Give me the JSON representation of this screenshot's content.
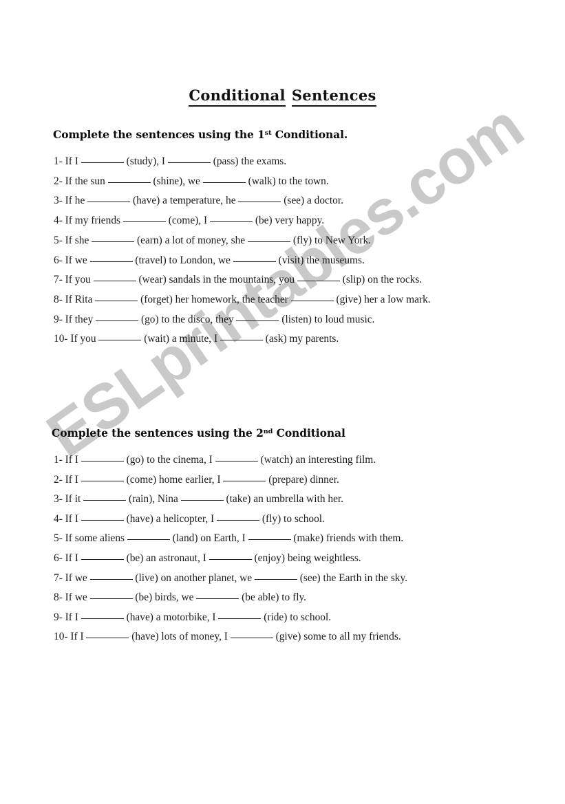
{
  "document": {
    "title_word_1": "Conditional",
    "title_word_2": "Sentences"
  },
  "watermark": {
    "text": "ESLprintables.com",
    "color": "#c9c9c9"
  },
  "colors": {
    "page_background": "#ffffff",
    "body_text": "#1c1c1c",
    "heading_text": "#0d0d0d"
  },
  "sections": [
    {
      "heading_prefix": "Complete the sentences using the 1",
      "heading_ordinal": "st",
      "heading_suffix": " Conditional.",
      "items": [
        "1- If I ________ (study), I ________ (pass) the exams.",
        "2- If the sun ________ (shine), we ________ (walk) to the town.",
        "3- If he ________ (have) a temperature, he ________ (see) a doctor.",
        "4- If my friends ________ (come), I ________ (be) very happy.",
        "5- If she ________ (earn) a lot of money, she ________ (fly) to New York.",
        "6- If we ________ (travel) to London, we ________ (visit) the museums.",
        "7- If you ________ (wear) sandals in the mountains, you ________ (slip) on the rocks.",
        "8- If Rita ________ (forget) her homework, the teacher ________ (give) her a low mark.",
        "9- If they ________ (go) to the disco, they ________ (listen) to loud music.",
        "10- If you ________ (wait) a minute, I ________ (ask) my parents."
      ]
    },
    {
      "heading_prefix": "Complete the sentences using the 2",
      "heading_ordinal": "nd",
      "heading_suffix": " Conditional",
      "items": [
        "1- If I ________ (go) to the cinema, I ________ (watch) an interesting film.",
        "2- If I ________ (come) home earlier, I ________ (prepare) dinner.",
        "3- If it ________ (rain), Nina ________ (take) an umbrella with her.",
        "4- If I ________ (have) a helicopter, I ________ (fly) to school.",
        "5- If some aliens ________ (land) on Earth, I ________ (make) friends with them.",
        "6- If I ________ (be) an astronaut, I ________ (enjoy) being weightless.",
        "7- If we ________ (live) on another planet, we ________ (see) the Earth in the sky.",
        "8- If we ________ (be) birds, we ________ (be able) to fly.",
        "9- If I ________ (have) a motorbike, I ________ (ride) to school.",
        "10- If I ________ (have) lots of money, I ________ (give) some to all my friends."
      ]
    }
  ]
}
